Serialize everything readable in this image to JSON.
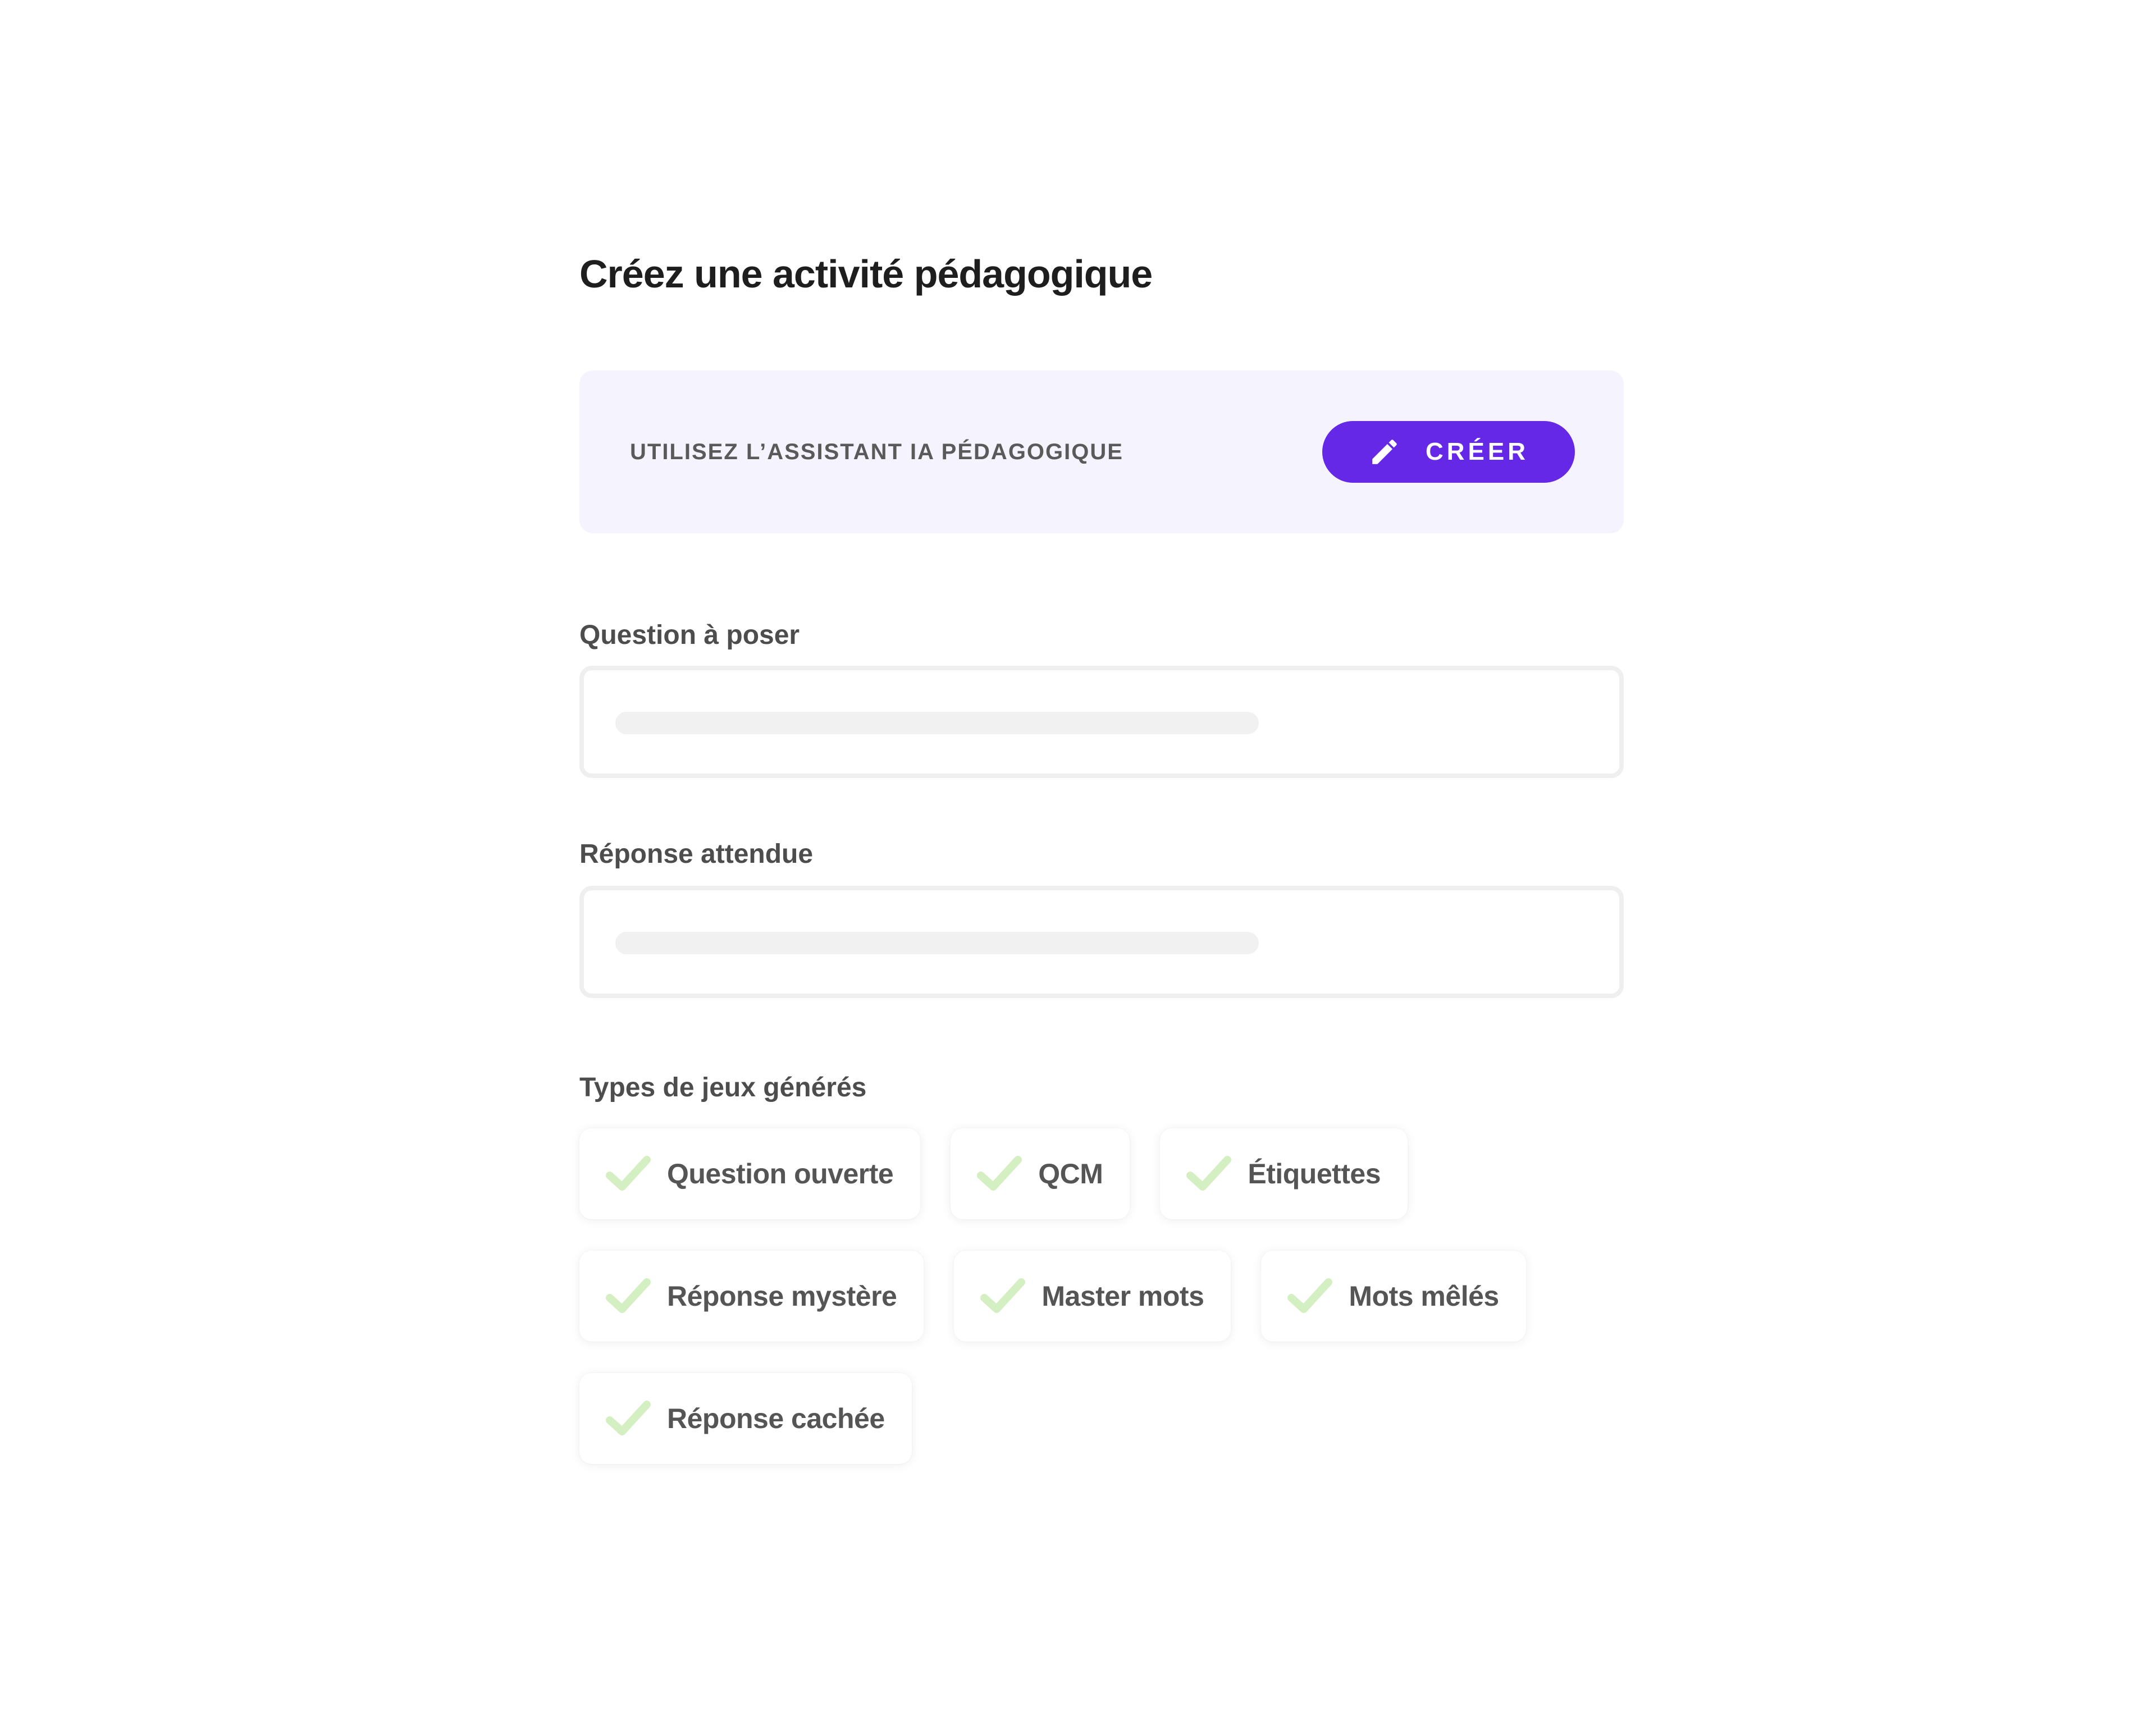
{
  "page": {
    "title": "Créez une activité pédagogique"
  },
  "assistant": {
    "label": "UTILISEZ L’ASSISTANT IA PÉDAGOGIQUE",
    "button_label": "CRÉER",
    "button_icon": "pencil-icon",
    "accent_color": "#6428e6",
    "card_background": "#f5f3fe"
  },
  "fields": {
    "question": {
      "label": "Question à poser",
      "value": ""
    },
    "answer": {
      "label": "Réponse attendue",
      "value": ""
    }
  },
  "game_types": {
    "label": "Types de jeux générés",
    "check_icon": "check-icon",
    "check_color": "#d4f0c2",
    "items": [
      {
        "label": "Question ouverte",
        "checked": true
      },
      {
        "label": "QCM",
        "checked": true
      },
      {
        "label": "Étiquettes",
        "checked": true
      },
      {
        "label": "Réponse mystère",
        "checked": true
      },
      {
        "label": "Master mots",
        "checked": true
      },
      {
        "label": "Mots mêlés",
        "checked": true
      },
      {
        "label": "Réponse cachée",
        "checked": true
      }
    ]
  }
}
